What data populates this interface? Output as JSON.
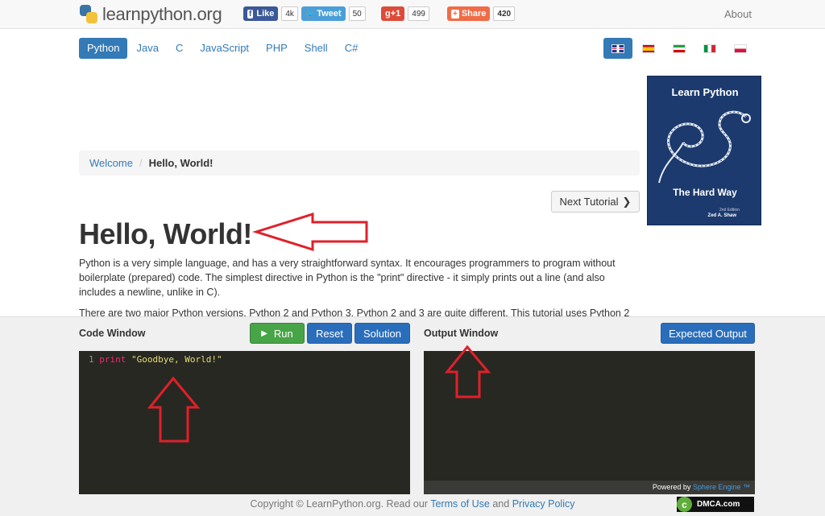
{
  "header": {
    "logo_text": "learnpython.org",
    "facebook": {
      "label": "Like",
      "count": "4k",
      "icon": "facebook-icon",
      "color": "#3b5998"
    },
    "twitter": {
      "label": "Tweet",
      "count": "50",
      "icon": "twitter-bird-icon",
      "color": "#4a9fd8"
    },
    "gplus": {
      "label": "g+1",
      "count": "499",
      "color": "#dd4b39"
    },
    "share": {
      "label": "Share",
      "count": "420",
      "icon": "plus-icon",
      "color": "#ef6c46"
    },
    "about_label": "About"
  },
  "nav": {
    "languages": [
      "Python",
      "Java",
      "C",
      "JavaScript",
      "PHP",
      "Shell",
      "C#"
    ],
    "active_index": 0,
    "flags": [
      "flag-uk",
      "flag-spain",
      "flag-iran",
      "flag-italy",
      "flag-poland"
    ]
  },
  "ad": {
    "title": "Learn Python",
    "subtitle": "The Hard Way",
    "edition": "2nd Edition",
    "author": "Zed A. Shaw"
  },
  "breadcrumb": {
    "parent": "Welcome",
    "current": "Hello, World!"
  },
  "next_tutorial_label": "Next Tutorial",
  "page_title": "Hello, World!",
  "content": {
    "p1": "Python is a very simple language, and has a very straightforward syntax. It encourages programmers to program without boilerplate (prepared) code. The simplest directive in Python is the \"print\" directive - it simply prints out a line (and also includes a newline, unlike in C).",
    "p2": "There are two major Python versions, Python 2 and Python 3. Python 2 and 3 are quite different. This tutorial uses Python 2"
  },
  "code_window": {
    "label": "Code Window",
    "run_label": "Run",
    "reset_label": "Reset",
    "solution_label": "Solution",
    "line_number": "1",
    "code_keyword": "print",
    "code_string": "\"Goodbye, World!\""
  },
  "output_window": {
    "label": "Output Window",
    "expected_label": "Expected Output",
    "powered_by": "Powered by",
    "engine": "Sphere Engine ™"
  },
  "footer": {
    "copyright": "Copyright © LearnPython.org. Read our",
    "terms": "Terms of Use",
    "and": "and",
    "privacy": "Privacy Policy",
    "badge": "DMCA.com"
  }
}
